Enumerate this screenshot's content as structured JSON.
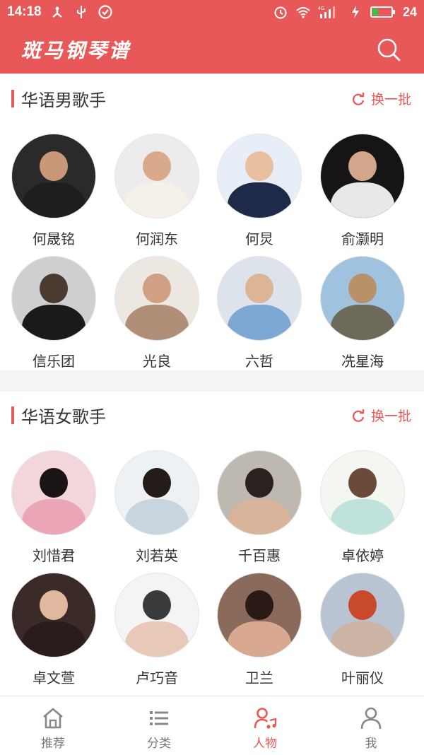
{
  "status": {
    "time": "14:18",
    "network": "4G",
    "battery": "24"
  },
  "app": {
    "title": "斑马钢琴谱"
  },
  "sections": [
    {
      "title": "华语男歌手",
      "refresh_label": "换一批",
      "singers": [
        {
          "name": "何晟铭",
          "bg": "#2a2a2a",
          "head": "#c99878",
          "body": "#1e1e1e"
        },
        {
          "name": "何润东",
          "bg": "#ececec",
          "head": "#d8a98a",
          "body": "#f5f1e8"
        },
        {
          "name": "何炅",
          "bg": "#e8eef8",
          "head": "#e8c0a0",
          "body": "#1e2a48"
        },
        {
          "name": "俞灏明",
          "bg": "#151515",
          "head": "#d2a68a",
          "body": "#e8e8e8"
        },
        {
          "name": "信乐团",
          "bg": "#cfcfcf",
          "head": "#4a3a30",
          "body": "#1a1a1a"
        },
        {
          "name": "光良",
          "bg": "#ece7e0",
          "head": "#cfa084",
          "body": "#b08e78"
        },
        {
          "name": "六哲",
          "bg": "#dde3ea",
          "head": "#dcb496",
          "body": "#7ea8d4"
        },
        {
          "name": "冼星海",
          "bg": "#9fc2df",
          "head": "#b8906a",
          "body": "#6d6a5a"
        }
      ]
    },
    {
      "title": "华语女歌手",
      "refresh_label": "换一批",
      "singers": [
        {
          "name": "刘惜君",
          "bg": "#f3d6dc",
          "head": "#1a1414",
          "body": "#eaa6b4"
        },
        {
          "name": "刘若英",
          "bg": "#eef1f4",
          "head": "#241c18",
          "body": "#c8d4de"
        },
        {
          "name": "千百惠",
          "bg": "#bdb8b0",
          "head": "#2a2220",
          "body": "#d8b49a"
        },
        {
          "name": "卓依婷",
          "bg": "#f4f6f2",
          "head": "#6a4a38",
          "body": "#bfe3dc"
        },
        {
          "name": "卓文萱",
          "bg": "#3a2a28",
          "head": "#e0b8a0",
          "body": "#2a1c1a"
        },
        {
          "name": "卢巧音",
          "bg": "#f4f4f4",
          "head": "#3a3a3a",
          "body": "#e8c8b8"
        },
        {
          "name": "卫兰",
          "bg": "#8a6a5a",
          "head": "#2a1a16",
          "body": "#d8a890"
        },
        {
          "name": "叶丽仪",
          "bg": "#b9c4d2",
          "head": "#c84a2a",
          "body": "#cbb4a4"
        }
      ]
    }
  ],
  "tabs": [
    {
      "label": "推荐",
      "icon": "home-icon"
    },
    {
      "label": "分类",
      "icon": "list-icon"
    },
    {
      "label": "人物",
      "icon": "person-music-icon",
      "active": true
    },
    {
      "label": "我",
      "icon": "profile-icon"
    }
  ],
  "colors": {
    "accent": "#e85858",
    "text": "#333333",
    "muted": "#777777"
  }
}
